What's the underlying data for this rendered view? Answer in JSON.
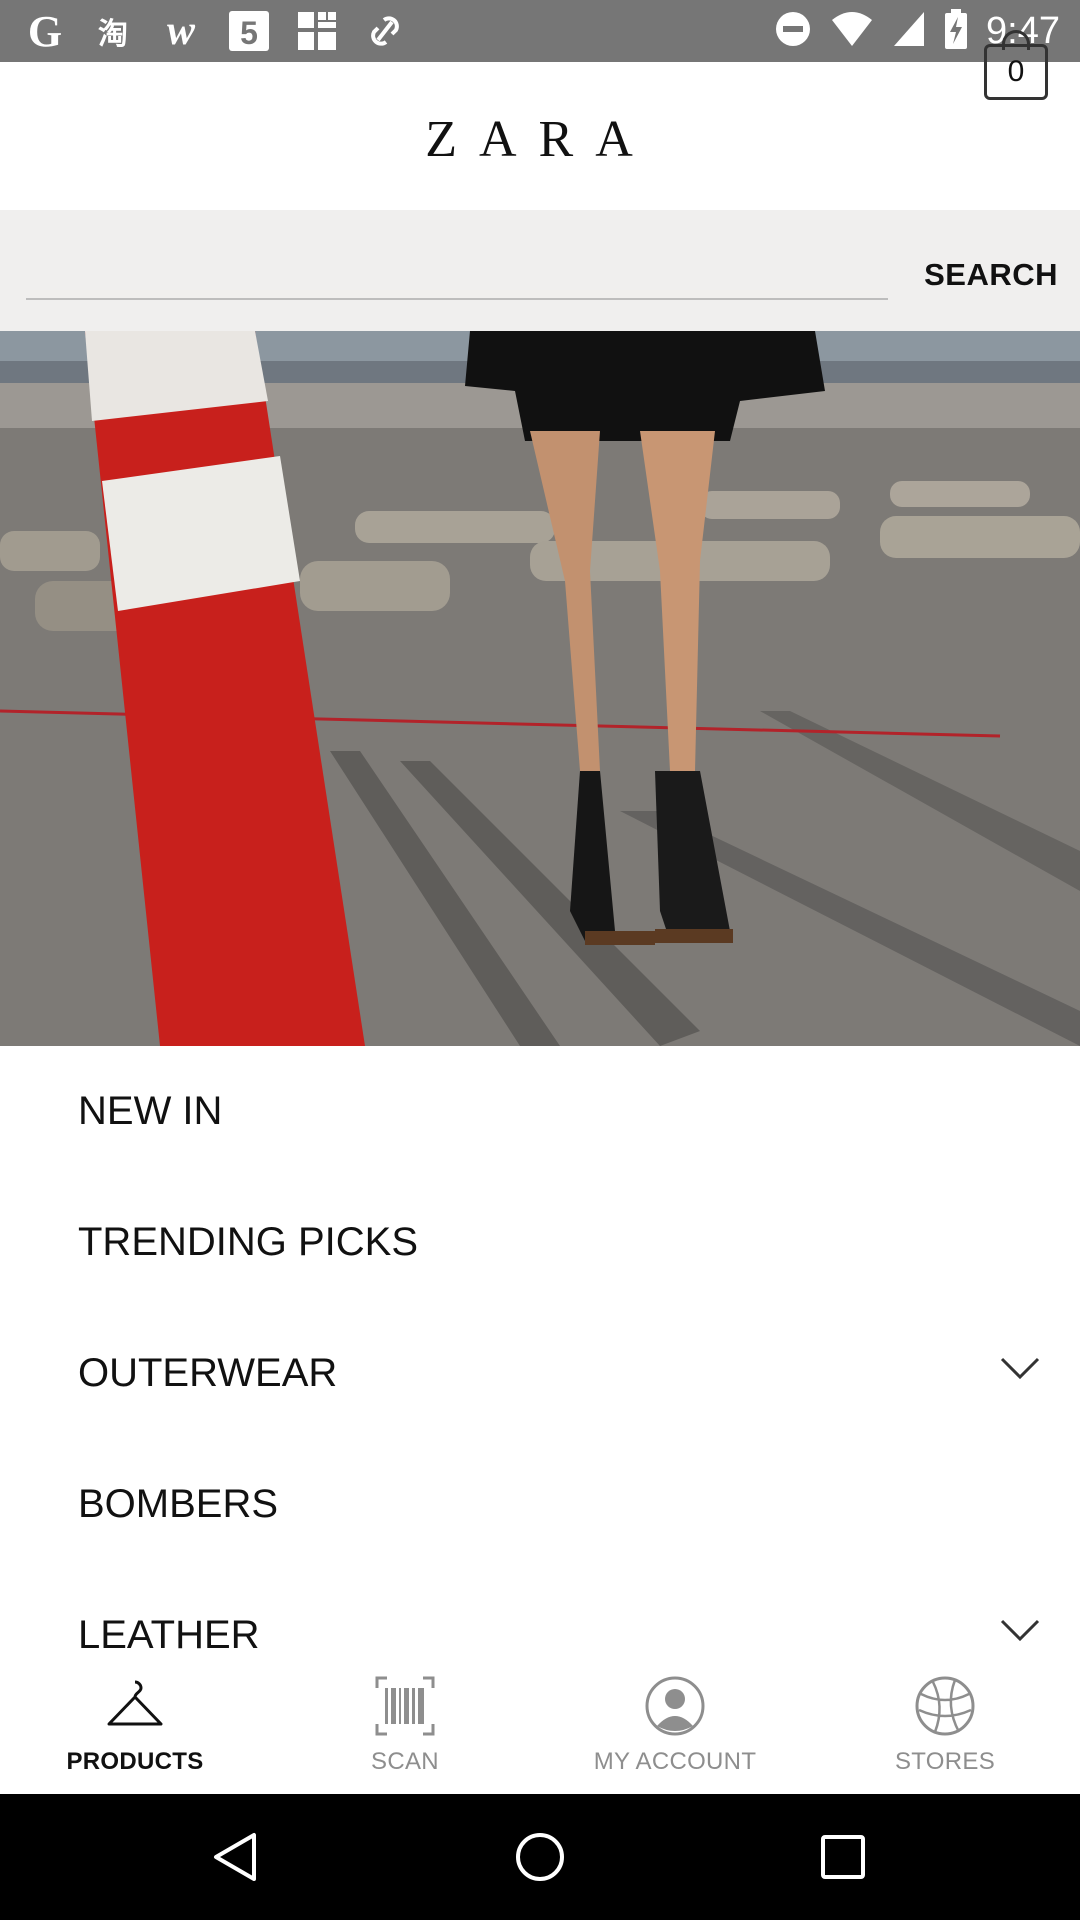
{
  "status_bar": {
    "time": "9:47",
    "left_icons": [
      "g-icon",
      "taobao-icon",
      "w-icon",
      "html5-icon",
      "grid-app-icon",
      "link-icon"
    ],
    "right_icons": [
      "dnd-icon",
      "wifi-icon",
      "signal-icon",
      "battery-charging-icon"
    ]
  },
  "header": {
    "logo": "ZARA",
    "cart_count": "0"
  },
  "search": {
    "button_label": "SEARCH",
    "placeholder": ""
  },
  "categories": [
    {
      "label": "NEW IN",
      "expandable": false
    },
    {
      "label": "TRENDING PICKS",
      "expandable": false
    },
    {
      "label": "OUTERWEAR",
      "expandable": true
    },
    {
      "label": "BOMBERS",
      "expandable": false
    },
    {
      "label": "LEATHER",
      "expandable": true
    }
  ],
  "bottom_nav": [
    {
      "label": "PRODUCTS",
      "icon": "hanger-icon",
      "active": true
    },
    {
      "label": "SCAN",
      "icon": "barcode-icon",
      "active": false
    },
    {
      "label": "MY ACCOUNT",
      "icon": "account-icon",
      "active": false
    },
    {
      "label": "STORES",
      "icon": "globe-icon",
      "active": false
    }
  ],
  "system_nav": {
    "icons": [
      "back-icon",
      "home-icon",
      "recents-icon"
    ]
  },
  "colors": {
    "status_bar": "#767676",
    "accent_red": "#c8201c",
    "active_nav": "#111111",
    "inactive_nav": "#8e8e8e"
  }
}
